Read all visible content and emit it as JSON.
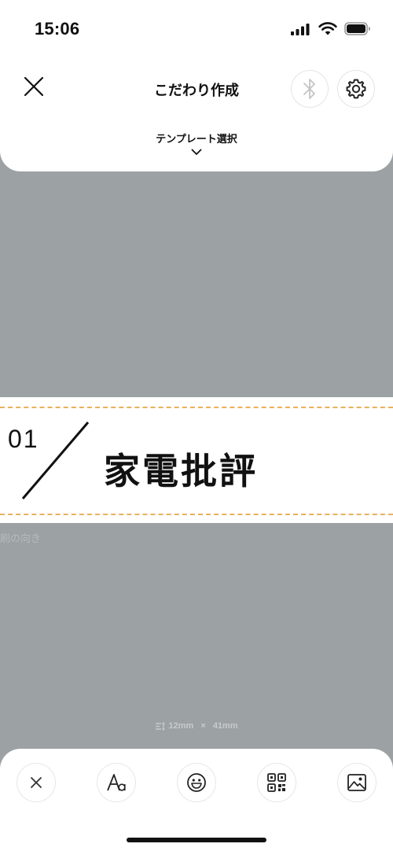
{
  "status_bar": {
    "time": "15:06",
    "icons": [
      "signal-icon",
      "wifi-icon",
      "battery-icon"
    ]
  },
  "header": {
    "title": "こだわり作成",
    "close_icon": "close-icon",
    "bluetooth_icon": "bluetooth-icon",
    "settings_icon": "gear-icon",
    "template_select_label": "テンプレート選択",
    "template_chevron_icon": "chevron-down-icon"
  },
  "label": {
    "number": "01",
    "text": "家電批評",
    "dash_color": "#e8b25c"
  },
  "canvas": {
    "orientation_text": "刷の向き",
    "size": {
      "height": "12mm",
      "separator": "×",
      "width": "41mm"
    },
    "background_color": "#9ca1a4"
  },
  "toolbar": {
    "buttons": [
      {
        "name": "delete",
        "icon": "close-icon"
      },
      {
        "name": "text",
        "icon": "text-font-icon"
      },
      {
        "name": "emoji",
        "icon": "smiley-icon"
      },
      {
        "name": "qr-code",
        "icon": "qr-code-icon"
      },
      {
        "name": "image",
        "icon": "image-icon"
      }
    ]
  }
}
